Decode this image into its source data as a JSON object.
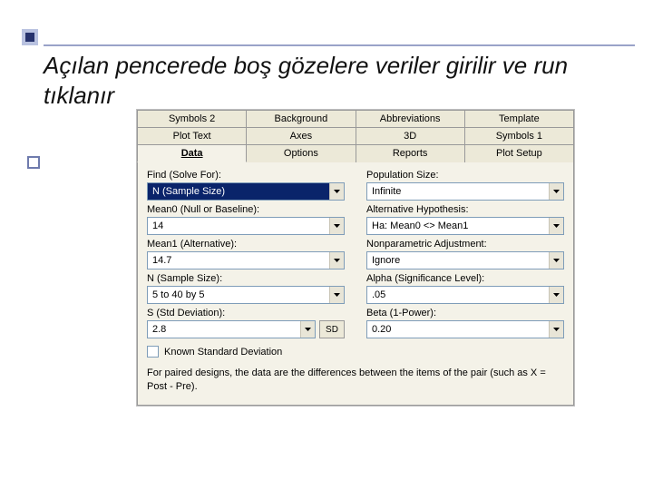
{
  "slide": {
    "title": "Açılan pencerede boş gözelere veriler girilir ve run tıklanır"
  },
  "tabs": {
    "row1": [
      "Symbols 2",
      "Background",
      "Abbreviations",
      "Template"
    ],
    "row2": [
      "Plot Text",
      "Axes",
      "3D",
      "Symbols 1"
    ],
    "row3": [
      "Data",
      "Options",
      "Reports",
      "Plot Setup"
    ],
    "selected": "Data"
  },
  "fields": {
    "find": {
      "label": "Find (Solve For):",
      "value": "N (Sample Size)"
    },
    "popsize": {
      "label": "Population Size:",
      "value": "Infinite"
    },
    "mean0": {
      "label": "Mean0 (Null or Baseline):",
      "value": "14"
    },
    "althyp": {
      "label": "Alternative Hypothesis:",
      "value": "Ha: Mean0 <> Mean1"
    },
    "mean1": {
      "label": "Mean1 (Alternative):",
      "value": "14.7"
    },
    "nonparam": {
      "label": "Nonparametric Adjustment:",
      "value": "Ignore"
    },
    "n": {
      "label": "N (Sample Size):",
      "value": "5 to 40 by 5"
    },
    "alpha": {
      "label": "Alpha (Significance Level):",
      "value": ".05"
    },
    "sd": {
      "label": "S (Std Deviation):",
      "value": "2.8",
      "btn": "SD"
    },
    "beta": {
      "label": "Beta (1-Power):",
      "value": "0.20"
    }
  },
  "checkbox": {
    "label": "Known Standard Deviation",
    "checked": false
  },
  "note": "For paired designs, the data are the differences between the items of the pair (such as X = Post - Pre)."
}
